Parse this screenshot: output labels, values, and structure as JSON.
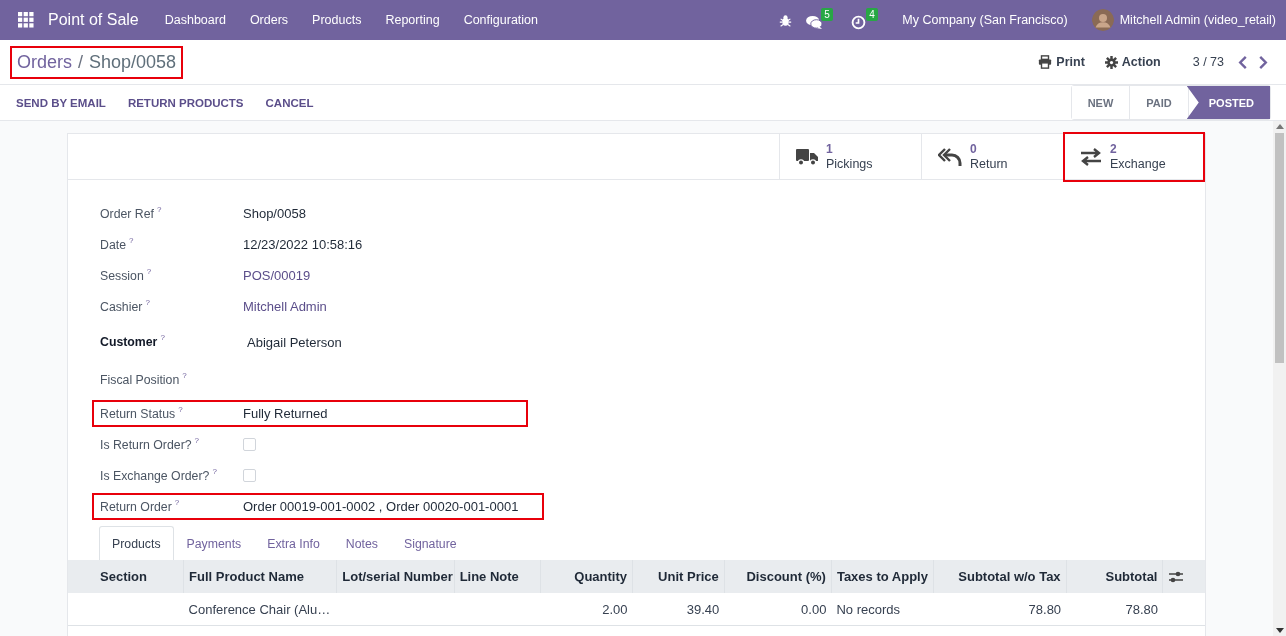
{
  "navbar": {
    "app_title": "Point of Sale",
    "menu": [
      "Dashboard",
      "Orders",
      "Products",
      "Reporting",
      "Configuration"
    ],
    "messages_badge": "5",
    "activities_badge": "4",
    "company": "My Company (San Francisco)",
    "user": "Mitchell Admin (video_retail)"
  },
  "breadcrumb": {
    "parent": "Orders",
    "separator": "/",
    "current": "Shop/0058",
    "highlighted": true
  },
  "toolbar": {
    "print": "Print",
    "action": "Action",
    "pager": "3 / 73"
  },
  "actions": [
    "SEND BY EMAIL",
    "RETURN PRODUCTS",
    "CANCEL"
  ],
  "stages": [
    {
      "label": "NEW",
      "selected": false
    },
    {
      "label": "PAID",
      "selected": false
    },
    {
      "label": "POSTED",
      "selected": true
    }
  ],
  "smart_buttons": [
    {
      "kind": "truck",
      "count": "1",
      "label": "Pickings",
      "highlighted": false
    },
    {
      "kind": "return",
      "count": "0",
      "label": "Return",
      "highlighted": false
    },
    {
      "kind": "exchange",
      "count": "2",
      "label": "Exchange",
      "highlighted": true
    }
  ],
  "fields": [
    {
      "label": "Order Ref",
      "kind": "text",
      "value": "Shop/0058",
      "bold": false,
      "highlighted": false
    },
    {
      "label": "Date",
      "kind": "text",
      "value": "12/23/2022 10:58:16",
      "bold": false,
      "highlighted": false
    },
    {
      "label": "Session",
      "kind": "link",
      "value": "POS/00019",
      "bold": false,
      "highlighted": false
    },
    {
      "label": "Cashier",
      "kind": "link",
      "value": "Mitchell Admin",
      "bold": false,
      "highlighted": false
    },
    {
      "label": "Customer",
      "kind": "text",
      "value": "Abigail Peterson",
      "bold": true,
      "highlighted": false
    },
    {
      "label": "Fiscal Position",
      "kind": "empty",
      "bold": false,
      "highlighted": false
    },
    {
      "label": "Return Status",
      "kind": "text",
      "value": "Fully Returned",
      "bold": false,
      "highlighted": true
    },
    {
      "label": "Is Return Order?",
      "kind": "checkbox",
      "checked": false,
      "bold": false,
      "highlighted": false
    },
    {
      "label": "Is Exchange Order?",
      "kind": "checkbox",
      "checked": false,
      "bold": false,
      "highlighted": false
    },
    {
      "label": "Return Order",
      "kind": "text",
      "value": "Order 00019-001-0002 , Order 00020-001-0001",
      "bold": false,
      "highlighted": true
    }
  ],
  "help_mark": "?",
  "tabs": [
    {
      "label": "Products",
      "selected": true
    },
    {
      "label": "Payments",
      "selected": false
    },
    {
      "label": "Extra Info",
      "selected": false
    },
    {
      "label": "Notes",
      "selected": false
    },
    {
      "label": "Signature",
      "selected": false
    }
  ],
  "table": {
    "columns": [
      "Section",
      "Full Product Name",
      "Lot/serial Number",
      "Line Note",
      "Quantity",
      "Unit Price",
      "Discount (%)",
      "Taxes to Apply",
      "Subtotal w/o Tax",
      "Subtotal"
    ],
    "rows": [
      [
        "",
        "Conference Chair (Alu…",
        "",
        "",
        "2.00",
        "39.40",
        "0.00",
        "No records",
        "78.80",
        "78.80"
      ]
    ]
  }
}
